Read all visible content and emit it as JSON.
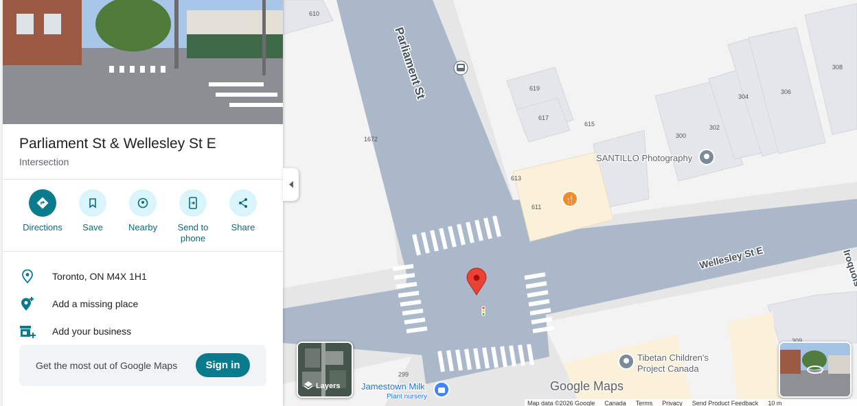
{
  "place": {
    "title": "Parliament St & Wellesley St E",
    "category": "Intersection"
  },
  "actions": [
    {
      "label": "Directions",
      "icon": "directions-icon"
    },
    {
      "label": "Save",
      "icon": "bookmark-icon"
    },
    {
      "label": "Nearby",
      "icon": "nearby-icon"
    },
    {
      "label": "Send to",
      "label2": "phone",
      "icon": "send-to-phone-icon"
    },
    {
      "label": "Share",
      "icon": "share-icon"
    }
  ],
  "info": {
    "address": "Toronto, ON M4X 1H1",
    "add_missing": "Add a missing place",
    "add_business": "Add your business"
  },
  "signin": {
    "message": "Get the most out of Google Maps",
    "button": "Sign in"
  },
  "map": {
    "streets": {
      "parliament": "Parliament St",
      "wellesley": "Wellesley St E",
      "iroquois": "Iroquois"
    },
    "numbers": [
      "610",
      "619",
      "617",
      "615",
      "1672",
      "613",
      "611",
      "300",
      "302",
      "304",
      "306",
      "308",
      "299",
      "309"
    ],
    "pois": {
      "santillo": "SANTILLO Photography",
      "tibetan_line1": "Tibetan Children's",
      "tibetan_line2": "Project Canada",
      "jamestown": "Jamestown Milk",
      "jamestown_sub": "Plant nursery"
    },
    "layers_label": "Layers",
    "logo": "Google Maps",
    "footer": [
      "Map data ©2026 Google",
      "Canada",
      "Terms",
      "Privacy",
      "Send Product Feedback",
      "10 m"
    ]
  },
  "colors": {
    "accent": "#0a7b8c",
    "road": "#aab8c9",
    "pin": "#ea4335",
    "food": "#f28c28"
  }
}
